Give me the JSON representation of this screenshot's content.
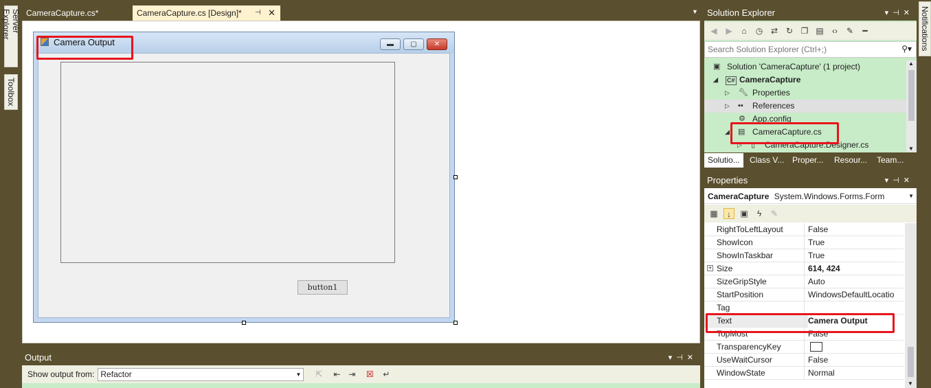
{
  "left_tabs": {
    "server_explorer": "Server Explorer",
    "toolbox": "Toolbox"
  },
  "right_tabs": {
    "notifications": "Notifications"
  },
  "doc_tabs": {
    "tab1": "CameraCapture.cs*",
    "tab2": "CameraCapture.cs [Design]*"
  },
  "form": {
    "title": "Camera Output",
    "button_label": "button1"
  },
  "solution_explorer": {
    "title": "Solution Explorer",
    "search_placeholder": "Search Solution Explorer (Ctrl+;)",
    "items": [
      "Solution 'CameraCapture' (1 project)",
      "CameraCapture",
      "Properties",
      "References",
      "App.config",
      "CameraCapture.cs",
      "CameraCapture.Designer.cs"
    ],
    "bottom_tabs": [
      "Solutio...",
      "Class V...",
      "Proper...",
      "Resour...",
      "Team..."
    ]
  },
  "properties": {
    "title": "Properties",
    "object_name": "CameraCapture",
    "object_type": "System.Windows.Forms.Form",
    "rows": [
      {
        "name": "RightToLeftLayout",
        "value": "False"
      },
      {
        "name": "ShowIcon",
        "value": "True"
      },
      {
        "name": "ShowInTaskbar",
        "value": "True"
      },
      {
        "name": "Size",
        "value": "614, 424"
      },
      {
        "name": "SizeGripStyle",
        "value": "Auto"
      },
      {
        "name": "StartPosition",
        "value": "WindowsDefaultLocatio"
      },
      {
        "name": "Tag",
        "value": ""
      },
      {
        "name": "Text",
        "value": "Camera Output"
      },
      {
        "name": "TopMost",
        "value": "False"
      },
      {
        "name": "TransparencyKey",
        "value": ""
      },
      {
        "name": "UseWaitCursor",
        "value": "False"
      },
      {
        "name": "WindowState",
        "value": "Normal"
      }
    ]
  },
  "output": {
    "title": "Output",
    "show_from_label": "Show output from:",
    "source": "Refactor"
  },
  "colors": {
    "highlight": "#e8141c",
    "tree_bg": "#c8ebc8",
    "frame": "#5a4f2e"
  }
}
